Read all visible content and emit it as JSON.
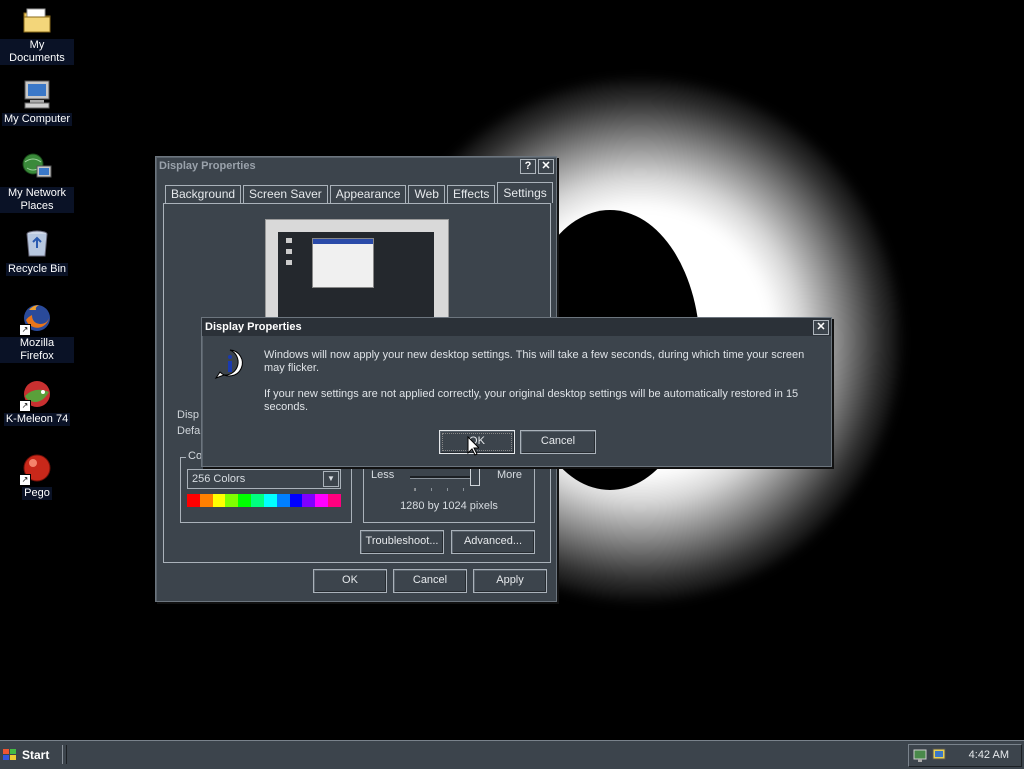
{
  "desktop": {
    "icons": [
      {
        "label": "My Documents",
        "icon": "folder-icon"
      },
      {
        "label": "My Computer",
        "icon": "computer-icon"
      },
      {
        "label": "My Network Places",
        "icon": "network-icon"
      },
      {
        "label": "Recycle Bin",
        "icon": "recycle-bin-icon"
      },
      {
        "label": "Mozilla Firefox",
        "icon": "firefox-icon"
      },
      {
        "label": "K-Meleon 74",
        "icon": "kmeleon-icon"
      },
      {
        "label": "Pego",
        "icon": "pego-icon"
      }
    ]
  },
  "display_props": {
    "title": "Display Properties",
    "help": "?",
    "close": "✕",
    "tabs": [
      "Background",
      "Screen Saver",
      "Appearance",
      "Web",
      "Effects",
      "Settings"
    ],
    "display_label_partial": "Disp",
    "default_label_partial": "Defa",
    "colors_group_partial": "Co",
    "colors_value": "256 Colors",
    "res_less": "Less",
    "res_more": "More",
    "res_text": "1280 by 1024 pixels",
    "troubleshoot": "Troubleshoot...",
    "advanced": "Advanced...",
    "ok": "OK",
    "cancel": "Cancel",
    "apply": "Apply"
  },
  "confirm": {
    "title": "Display Properties",
    "close": "✕",
    "msg1": "Windows will now apply your new desktop settings. This will take a few seconds, during which time your screen may flicker.",
    "msg2": "If your new settings are not applied correctly, your original desktop settings will be automatically restored in 15 seconds.",
    "ok": "OK",
    "cancel": "Cancel"
  },
  "taskbar": {
    "start": "Start",
    "clock": "4:42 AM"
  },
  "colors": {
    "palette": [
      "#ff0000",
      "#ff7f00",
      "#ffff00",
      "#7fff00",
      "#00ff00",
      "#00ff7f",
      "#00ffff",
      "#007fff",
      "#0000ff",
      "#7f00ff",
      "#ff00ff",
      "#ff007f"
    ]
  }
}
